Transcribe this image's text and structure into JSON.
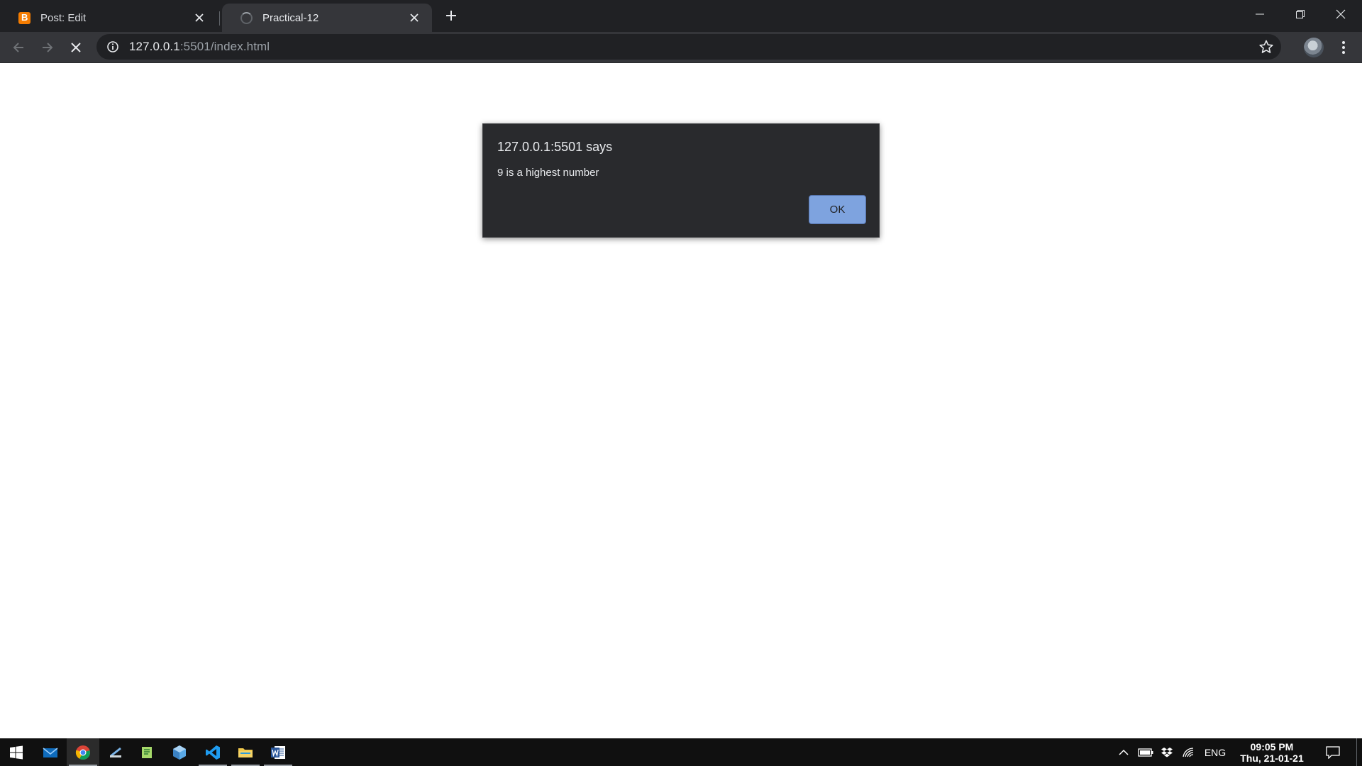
{
  "browser": {
    "tabs": [
      {
        "title": "Post: Edit",
        "favicon": "blogger-icon",
        "active": false
      },
      {
        "title": "Practical-12",
        "favicon": "loading-icon",
        "active": true
      }
    ],
    "address": {
      "host": "127.0.0.1",
      "rest": ":5501/index.html"
    },
    "colors": {
      "frame": "#202124",
      "toolbar": "#35363a"
    }
  },
  "dialog": {
    "heading": "127.0.0.1:5501 says",
    "message": "9 is a highest number",
    "ok_label": "OK",
    "ok_color": "#8ab4f8"
  },
  "taskbar": {
    "pinned": [
      "windows-start-icon",
      "mail-icon",
      "chrome-icon",
      "cmd-icon",
      "notepad-icon",
      "3d-viewer-icon",
      "vscode-icon",
      "file-explorer-icon",
      "word-icon"
    ],
    "language": "ENG",
    "time": "09:05 PM",
    "date": "Thu, 21-01-21"
  }
}
